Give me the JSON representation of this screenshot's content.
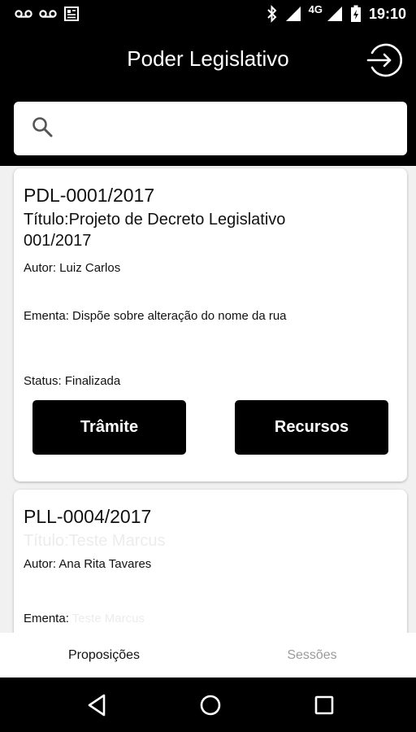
{
  "status_bar": {
    "time": "19:10",
    "network": "4G",
    "icons": [
      "voicemail-icon",
      "voicemail-icon",
      "news-icon",
      "bluetooth-icon",
      "signal-icon",
      "signal-icon",
      "battery-charging-icon"
    ]
  },
  "header": {
    "title": "Poder Legislativo",
    "logout_icon": "logout-icon"
  },
  "search": {
    "placeholder": "",
    "icon": "search-icon"
  },
  "proposals": [
    {
      "code": "PDL-0001/2017",
      "title": "Título:Projeto de Decreto Legislativo 001/2017",
      "author": "Autor: Luiz Carlos",
      "ementa": "Ementa: Dispõe sobre alteração do nome da rua",
      "status": "Status: Finalizada",
      "buttons": {
        "tramite": "Trâmite",
        "recursos": "Recursos"
      }
    },
    {
      "code": "PLL-0004/2017",
      "title": "Título:Teste Marcus",
      "author": "Autor: Ana Rita Tavares",
      "ementa_label": "Ementa:",
      "ementa_value": "Teste Marcus"
    }
  ],
  "tabs": [
    {
      "label": "Proposições",
      "active": true
    },
    {
      "label": "Sessões",
      "active": false
    }
  ],
  "colors": {
    "bar_background": "#000000",
    "page_background": "#f1f1f1",
    "card_background": "#ffffff",
    "button_background": "#000000",
    "inactive_tab": "#9b9b9b"
  }
}
